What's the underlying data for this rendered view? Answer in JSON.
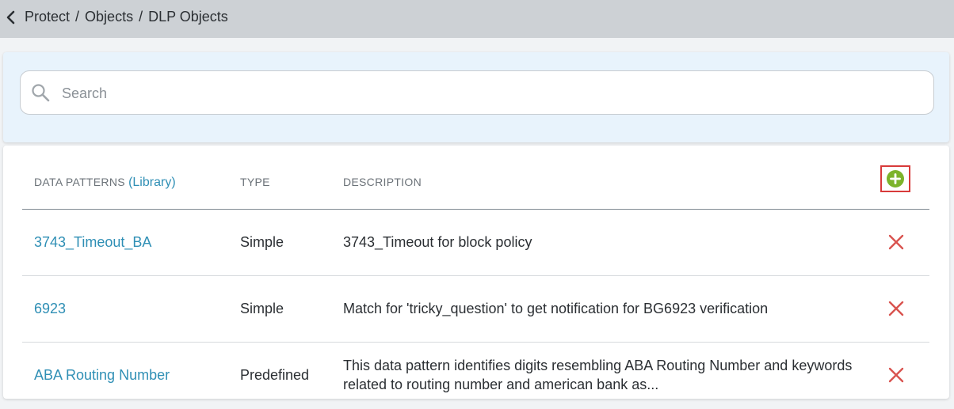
{
  "breadcrumb": {
    "items": [
      "Protect",
      "Objects",
      "DLP Objects"
    ],
    "separator": "/"
  },
  "search": {
    "placeholder": "Search",
    "value": ""
  },
  "table": {
    "headers": {
      "name": "DATA PATTERNS",
      "library": "(Library)",
      "type": "TYPE",
      "description": "DESCRIPTION"
    },
    "rows": [
      {
        "name": "3743_Timeout_BA",
        "type": "Simple",
        "description": "3743_Timeout for block policy"
      },
      {
        "name": "6923",
        "type": "Simple",
        "description": "Match for 'tricky_question' to get notification for BG6923 verification"
      },
      {
        "name": "ABA Routing Number",
        "type": "Predefined",
        "description": "This data pattern identifies digits resembling ABA Routing Number and keywords related to routing number and american bank as..."
      }
    ]
  },
  "colors": {
    "link": "#2f8fb5",
    "add": "#7cb32b",
    "delete": "#d9534f",
    "highlight": "#d83a3a"
  }
}
